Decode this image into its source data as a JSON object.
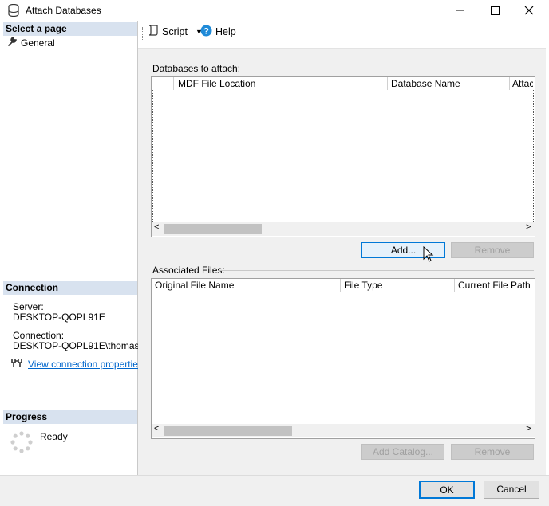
{
  "window": {
    "title": "Attach Databases"
  },
  "left": {
    "select_page_header": "Select a page",
    "pages": [
      {
        "label": "General"
      }
    ],
    "connection_header": "Connection",
    "server_label": "Server:",
    "server_value": "DESKTOP-QOPL91E",
    "connection_label": "Connection:",
    "connection_value": "DESKTOP-QOPL91E\\thomas",
    "view_properties_link": "View connection properties",
    "progress_header": "Progress",
    "progress_status": "Ready"
  },
  "toolbar": {
    "script_label": "Script",
    "help_label": "Help"
  },
  "databases": {
    "label": "Databases to attach:",
    "columns": [
      "MDF File Location",
      "Database Name",
      "Attach As"
    ],
    "add_label": "Add...",
    "remove_label": "Remove"
  },
  "associated": {
    "label": "Associated Files:",
    "columns": [
      "Original File Name",
      "File Type",
      "Current File Path"
    ],
    "add_catalog_label": "Add Catalog...",
    "remove_label": "Remove"
  },
  "footer": {
    "ok_label": "OK",
    "cancel_label": "Cancel"
  },
  "icons": {
    "db": "database-icon",
    "wrench": "wrench-icon",
    "script": "script-icon",
    "help": "help-icon",
    "connect": "connection-icon",
    "spinner": "progress-spinner-icon"
  },
  "colors": {
    "section_header": "#d8e2ef",
    "accent": "#0078d7",
    "link": "#0066cc"
  }
}
